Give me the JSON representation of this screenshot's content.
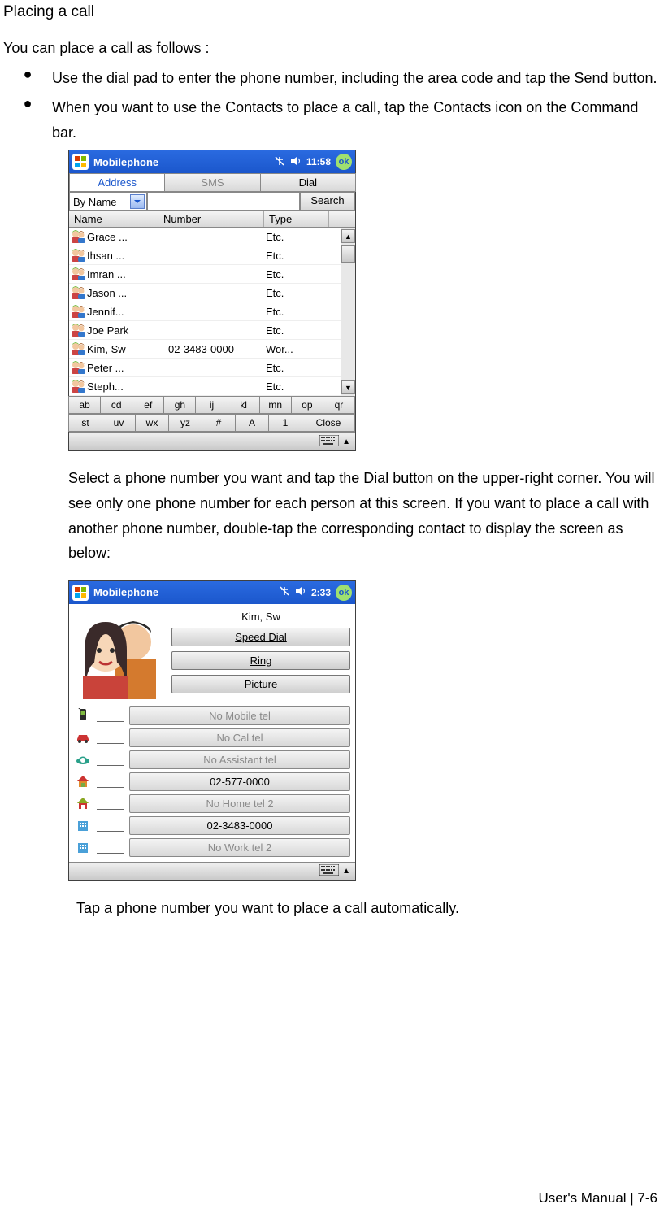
{
  "heading": "Placing a call",
  "intro": "You can place a call as follows :",
  "bullet1": "Use the dial pad to enter the phone number, including the area code and tap the Send button.",
  "bullet2": "When you want to use the Contacts to place a call, tap the Contacts icon on the Command bar.",
  "para_after_shot1": "Select a phone number you want and tap the Dial button on the upper-right corner. You will see only one phone number for each person at this screen. If you want to place a call with another phone number, double-tap the corresponding contact to display the screen as below:",
  "para_end": "Tap a phone number you want to place a call automatically.",
  "footer": "User's Manual  |  7-6",
  "shot1": {
    "titlebar": {
      "app": "Mobilephone",
      "time": "11:58",
      "ok": "ok"
    },
    "tabs": {
      "address": "Address",
      "sms": "SMS",
      "dial": "Dial"
    },
    "search": {
      "byname": "By Name",
      "search_btn": "Search"
    },
    "columns": {
      "name": "Name",
      "number": "Number",
      "type": "Type"
    },
    "rows": [
      {
        "name": "Grace ...",
        "number": "",
        "type": "Etc."
      },
      {
        "name": "Ihsan ...",
        "number": "",
        "type": "Etc."
      },
      {
        "name": "Imran ...",
        "number": "",
        "type": "Etc."
      },
      {
        "name": "Jason ...",
        "number": "",
        "type": "Etc."
      },
      {
        "name": "Jennif...",
        "number": "",
        "type": "Etc."
      },
      {
        "name": "Joe Park",
        "number": "",
        "type": "Etc."
      },
      {
        "name": "Kim, Sw",
        "number": "02-3483-0000",
        "type": "Wor..."
      },
      {
        "name": "Peter ...",
        "number": "",
        "type": "Etc."
      },
      {
        "name": "Steph...",
        "number": "",
        "type": "Etc."
      }
    ],
    "letters1": [
      "ab",
      "cd",
      "ef",
      "gh",
      "ij",
      "kl",
      "mn",
      "op",
      "qr"
    ],
    "letters2": [
      "st",
      "uv",
      "wx",
      "yz",
      "#",
      "A",
      "1",
      "Close"
    ]
  },
  "shot2": {
    "titlebar": {
      "app": "Mobilephone",
      "time": "2:33",
      "ok": "ok"
    },
    "contact_name": "Kim, Sw",
    "buttons": {
      "speed": "Speed Dial",
      "ring": "Ring",
      "picture": "Picture"
    },
    "phones": [
      {
        "icon": "mobile",
        "label": "No Mobile tel",
        "enabled": false
      },
      {
        "icon": "car",
        "label": "No Cal tel",
        "enabled": false
      },
      {
        "icon": "assist",
        "label": "No Assistant tel",
        "enabled": false
      },
      {
        "icon": "home",
        "label": "02-577-0000",
        "enabled": true
      },
      {
        "icon": "home2",
        "label": "No Home tel 2",
        "enabled": false
      },
      {
        "icon": "work",
        "label": "02-3483-0000",
        "enabled": true
      },
      {
        "icon": "work2",
        "label": "No Work tel 2",
        "enabled": false
      }
    ]
  }
}
